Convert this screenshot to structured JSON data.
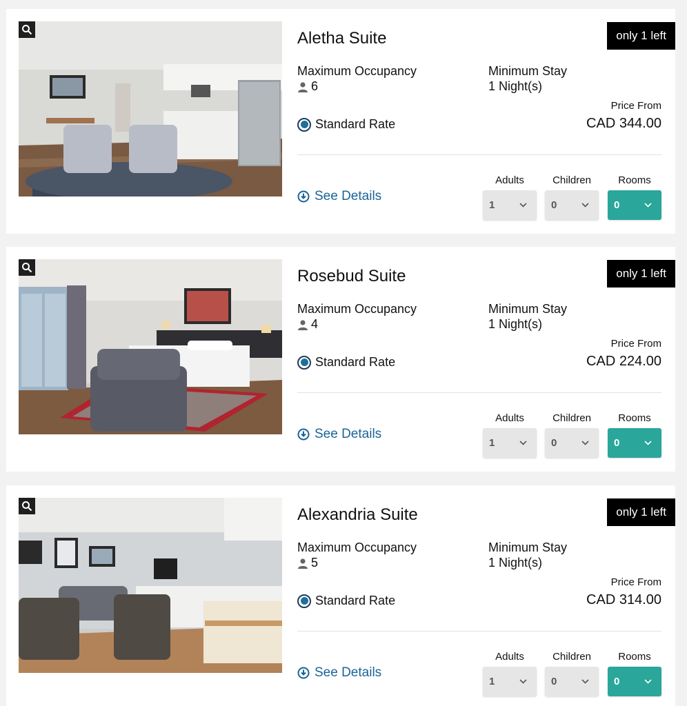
{
  "rooms": [
    {
      "name": "Aletha Suite",
      "availability_badge": "only 1 left",
      "occupancy_label": "Maximum Occupancy",
      "occupancy_value": "6",
      "min_stay_label": "Minimum Stay",
      "min_stay_value": "1 Night(s)",
      "price_label": "Price From",
      "price_value": "CAD 344.00",
      "rate_label": "Standard Rate",
      "details_label": "See Details",
      "adults_label": "Adults",
      "adults_value": "1",
      "children_label": "Children",
      "children_value": "0",
      "rooms_label": "Rooms",
      "rooms_value": "0"
    },
    {
      "name": "Rosebud Suite",
      "availability_badge": "only 1 left",
      "occupancy_label": "Maximum Occupancy",
      "occupancy_value": "4",
      "min_stay_label": "Minimum Stay",
      "min_stay_value": "1 Night(s)",
      "price_label": "Price From",
      "price_value": "CAD 224.00",
      "rate_label": "Standard Rate",
      "details_label": "See Details",
      "adults_label": "Adults",
      "adults_value": "1",
      "children_label": "Children",
      "children_value": "0",
      "rooms_label": "Rooms",
      "rooms_value": "0"
    },
    {
      "name": "Alexandria Suite",
      "availability_badge": "only 1 left",
      "occupancy_label": "Maximum Occupancy",
      "occupancy_value": "5",
      "min_stay_label": "Minimum Stay",
      "min_stay_value": "1 Night(s)",
      "price_label": "Price From",
      "price_value": "CAD 314.00",
      "rate_label": "Standard Rate",
      "details_label": "See Details",
      "adults_label": "Adults",
      "adults_value": "1",
      "children_label": "Children",
      "children_value": "0",
      "rooms_label": "Rooms",
      "rooms_value": "0"
    }
  ],
  "icons": {
    "zoom": "magnifier-icon",
    "occupancy": "person-icon",
    "details": "circle-arrow-down-icon",
    "select": "chevron-down-icon",
    "rate": "radio-selected-icon"
  },
  "colors": {
    "accent_teal": "#2aa69a",
    "link_blue": "#1a6497",
    "badge_black": "#000000",
    "select_gray": "#e6e6e6"
  }
}
